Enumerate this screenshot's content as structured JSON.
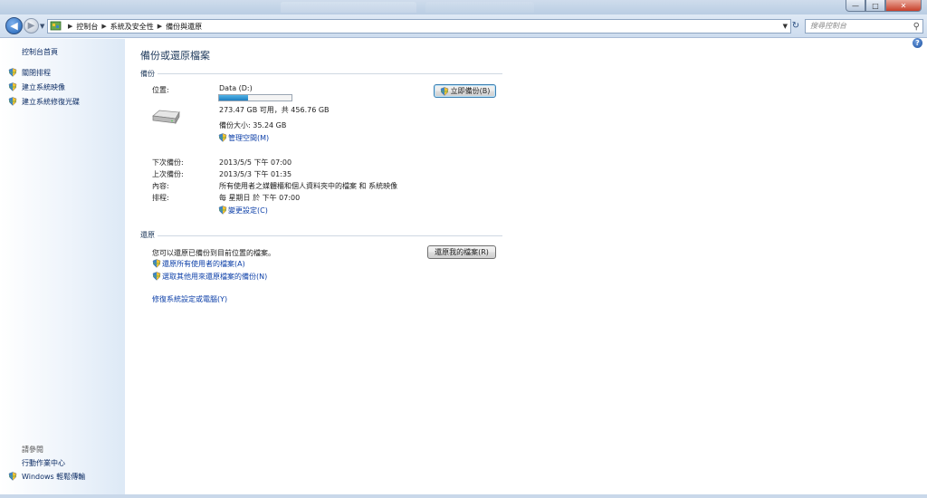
{
  "window": {
    "minimize": "—",
    "maximize": "□",
    "close": "✕"
  },
  "nav": {
    "back_icon": "arrow-left-icon",
    "forward_icon": "arrow-right-icon"
  },
  "breadcrumb": [
    "控制台",
    "系統及安全性",
    "備份與還原"
  ],
  "search": {
    "placeholder": "搜尋控制台"
  },
  "sidebar": {
    "home": "控制台首頁",
    "items": [
      {
        "label": "關閉排程",
        "icon": "shield-icon"
      },
      {
        "label": "建立系統映像",
        "icon": "shield-icon"
      },
      {
        "label": "建立系統修復光碟",
        "icon": "shield-icon"
      }
    ],
    "see_also_title": "請參閱",
    "see_also": [
      {
        "label": "行動作業中心",
        "icon": ""
      },
      {
        "label": "Windows 輕鬆傳輸",
        "icon": "shield-icon"
      }
    ]
  },
  "main": {
    "title": "備份或還原檔案",
    "backup": {
      "section": "備份",
      "location_label": "位置:",
      "drive_name": "Data (D:)",
      "used_fraction": 0.4,
      "space_text": "273.47 GB 可用，共 456.76 GB",
      "size_text": "備份大小: 35.24 GB",
      "manage_link": "管理空間(M)",
      "backup_now_button": "立即備份(B)",
      "next_label": "下次備份:",
      "next_value": "2013/5/5 下午 07:00",
      "last_label": "上次備份:",
      "last_value": "2013/5/3 下午 01:35",
      "contents_label": "內容:",
      "contents_value": "所有使用者之媒體櫃和個人資料夾中的檔案 和 系統映像",
      "schedule_label": "排程:",
      "schedule_value": "每 星期日 於 下午 07:00",
      "change_settings_link": "變更設定(C)"
    },
    "restore": {
      "section": "還原",
      "description": "您可以還原已備份到目前位置的檔案。",
      "restore_my_files_button": "還原我的檔案(R)",
      "restore_all_link": "還原所有使用者的檔案(A)",
      "select_other_link": "選取其他用來還原檔案的備份(N)",
      "recover_link": "修復系統設定或電腦(Y)"
    }
  },
  "colors": {
    "accent": "#1e395b",
    "link": "#0c3fa8",
    "progress": "#1f7ec1"
  }
}
